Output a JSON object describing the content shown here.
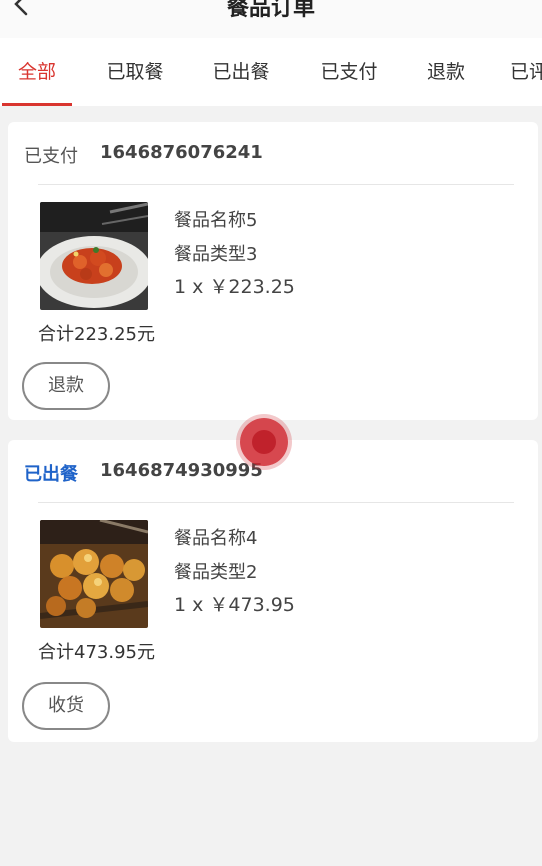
{
  "header": {
    "title": "餐品订单"
  },
  "tabs": [
    {
      "label": "全部",
      "active": true
    },
    {
      "label": "已取餐",
      "active": false
    },
    {
      "label": "已出餐",
      "active": false
    },
    {
      "label": "已支付",
      "active": false
    },
    {
      "label": "退款",
      "active": false
    },
    {
      "label": "已评",
      "active": false
    }
  ],
  "orders": [
    {
      "status": "已支付",
      "order_no": "1646876076241",
      "item_name": "餐品名称5",
      "item_type": "餐品类型3",
      "item_price": "1 x ￥223.25",
      "total": "合计223.25元",
      "action_label": "退款"
    },
    {
      "status": "已出餐",
      "order_no": "1646874930995",
      "item_name": "餐品名称4",
      "item_type": "餐品类型2",
      "item_price": "1 x ￥473.95",
      "total": "合计473.95元",
      "action_label": "收货"
    }
  ],
  "colors": {
    "accent": "#d9352f",
    "shipped_status": "#1f63c9"
  }
}
